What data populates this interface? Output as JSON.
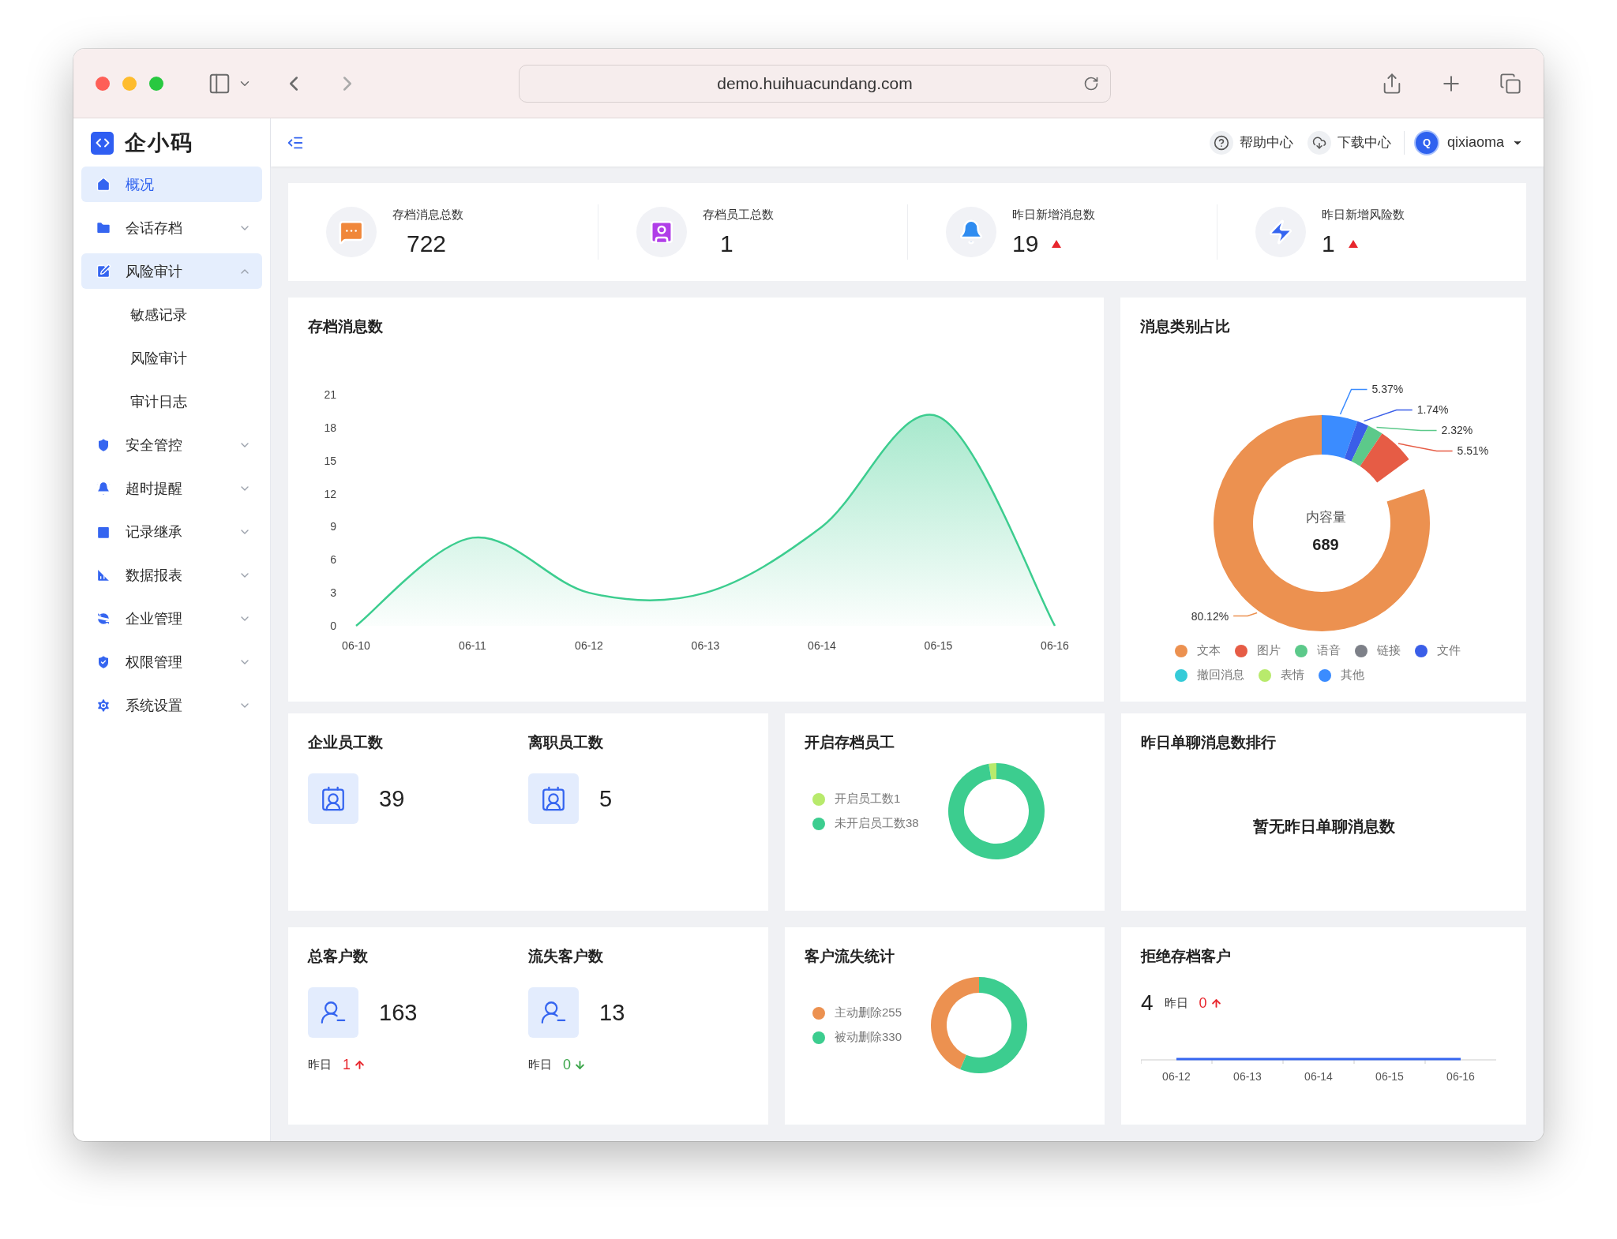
{
  "browser": {
    "url": "demo.huihuacundang.com"
  },
  "sidebar": {
    "logo": "企小码",
    "items": [
      {
        "label": "概况",
        "selected": true
      },
      {
        "label": "会话存档",
        "selected": false,
        "expanded": false
      },
      {
        "label": "风险审计",
        "selected": false,
        "expanded": true,
        "children": [
          {
            "label": "敏感记录",
            "selected": false
          },
          {
            "label": "风险审计",
            "selected": false
          },
          {
            "label": "审计日志",
            "selected": false
          }
        ]
      },
      {
        "label": "安全管控",
        "selected": false,
        "expanded": false
      },
      {
        "label": "超时提醒",
        "selected": false,
        "expanded": false
      },
      {
        "label": "记录继承",
        "selected": false,
        "expanded": false
      },
      {
        "label": "数据报表",
        "selected": false,
        "expanded": false
      },
      {
        "label": "企业管理",
        "selected": false,
        "expanded": false
      },
      {
        "label": "权限管理",
        "selected": false,
        "expanded": false
      },
      {
        "label": "系统设置",
        "selected": false,
        "expanded": false
      }
    ]
  },
  "header": {
    "help": "帮助中心",
    "download": "下载中心",
    "user": {
      "initial": "Q",
      "name": "qixiaoma"
    }
  },
  "stats": [
    {
      "label": "存档消息总数",
      "value": "722",
      "kind": "plain"
    },
    {
      "label": "存档员工总数",
      "value": "1",
      "kind": "plain"
    },
    {
      "label": "昨日新增消息数",
      "value": "19",
      "kind": "rising"
    },
    {
      "label": "昨日新增风险数",
      "value": "1",
      "kind": "rising"
    }
  ],
  "messages_chart": {
    "title": "存档消息数",
    "chart_data": {
      "type": "area",
      "categories": [
        "06-10",
        "06-11",
        "06-12",
        "06-13",
        "06-14",
        "06-15",
        "06-16"
      ],
      "values": [
        0,
        8,
        3,
        3,
        9,
        19,
        0
      ],
      "yticks": [
        0,
        3,
        6,
        9,
        12,
        15,
        18,
        21
      ],
      "ylim": [
        0,
        21
      ]
    }
  },
  "category_chart": {
    "title": "消息类别占比",
    "center_label": "内容量",
    "center_value": "689",
    "legend": [
      {
        "color": "#ec9150"
      },
      {
        "color": "#e65c45"
      },
      {
        "color": "#5cc98a"
      },
      {
        "color": "#7d8088"
      },
      {
        "color": "#3a5ee8"
      },
      {
        "color": "#35cbd8"
      },
      {
        "color": "#b8ea6c"
      },
      {
        "color": "#3b8cff"
      }
    ],
    "chart_data": {
      "type": "donut",
      "categories": [
        "文本",
        "图片",
        "语音",
        "链接",
        "文件",
        "撤回消息",
        "表情",
        "其他"
      ],
      "values": [
        80.12,
        5.51,
        2.32,
        null,
        1.74,
        null,
        null,
        5.37
      ],
      "value_labels": [
        "80.12%",
        "5.51%",
        "2.32%",
        null,
        "1.74%",
        null,
        null,
        "5.37%"
      ]
    }
  },
  "employees": [
    {
      "title": "企业员工数",
      "value": "39"
    },
    {
      "title": "离职员工数",
      "value": "5"
    }
  ],
  "archive_staff": {
    "title": "开启存档员工",
    "legend": [
      {
        "color": "#b8ea6c"
      },
      {
        "color": "#3ccd8f"
      }
    ],
    "chart_data": {
      "type": "donut",
      "categories": [
        "开启员工数1",
        "未开启员工数38"
      ],
      "values": [
        2.56,
        97.44
      ]
    }
  },
  "ranking": {
    "title": "昨日单聊消息数排行",
    "empty_text": "暂无昨日单聊消息数"
  },
  "customers": [
    {
      "title": "总客户数",
      "value": "163",
      "yesterday": {
        "label": "昨日",
        "value": "1",
        "kind": "up"
      }
    },
    {
      "title": "流失客户数",
      "value": "13",
      "yesterday": {
        "label": "昨日",
        "value": "0",
        "kind": "down"
      }
    }
  ],
  "churn": {
    "title": "客户流失统计",
    "legend": [
      {
        "color": "#ec9150"
      },
      {
        "color": "#3ccd8f"
      }
    ],
    "chart_data": {
      "type": "donut",
      "categories": [
        "主动删除255",
        "被动删除330"
      ],
      "values": [
        43.59,
        56.41
      ]
    }
  },
  "rejected": {
    "title": "拒绝存档客户",
    "value": "4",
    "yesterday": {
      "label": "昨日",
      "value": "0",
      "kind": "up"
    },
    "x_labels": [
      "06-12",
      "06-13",
      "06-14",
      "06-15",
      "06-16"
    ]
  }
}
